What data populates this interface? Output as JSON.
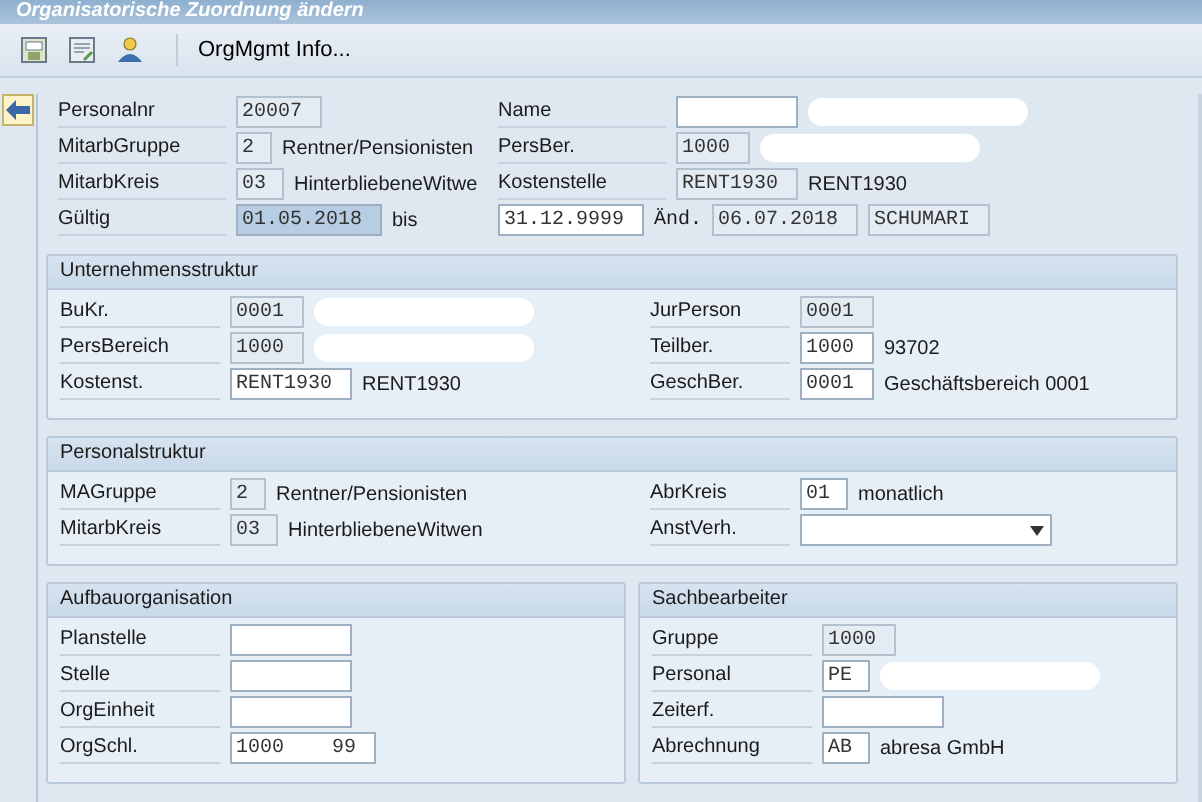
{
  "title": "Organisatorische Zuordnung ändern",
  "toolbar": {
    "info_button": "OrgMgmt Info..."
  },
  "header": {
    "rows": [
      {
        "left": [
          {
            "kind": "label",
            "text": "Personalnr"
          },
          {
            "kind": "field",
            "value": "20007",
            "editable": false
          }
        ],
        "right": [
          {
            "kind": "label",
            "text": "Name"
          },
          {
            "kind": "field",
            "editable": true
          },
          {
            "kind": "redacted"
          }
        ]
      },
      {
        "left": [
          {
            "kind": "label",
            "text": "MitarbGruppe"
          },
          {
            "kind": "field",
            "value": "2",
            "editable": false
          },
          {
            "kind": "text",
            "text": "Rentner/Pensionisten"
          }
        ],
        "right": [
          {
            "kind": "label",
            "text": "PersBer."
          },
          {
            "kind": "field",
            "value": "1000",
            "editable": false
          },
          {
            "kind": "redacted"
          }
        ]
      },
      {
        "left": [
          {
            "kind": "label",
            "text": "MitarbKreis"
          },
          {
            "kind": "field",
            "value": "03",
            "editable": false
          },
          {
            "kind": "text",
            "text": "HinterbliebeneWitwe"
          }
        ],
        "right": [
          {
            "kind": "label",
            "text": "Kostenstelle"
          },
          {
            "kind": "field",
            "value": "RENT1930",
            "editable": false
          },
          {
            "kind": "text",
            "text": "RENT1930"
          }
        ]
      },
      {
        "left": [
          {
            "kind": "label",
            "text": "Gültig"
          },
          {
            "kind": "field",
            "value": "01.05.2018",
            "editable": true,
            "highlighted": true
          },
          {
            "kind": "text",
            "text": "bis"
          }
        ],
        "right": [
          {
            "kind": "field",
            "value": "31.12.9999",
            "editable": true
          },
          {
            "kind": "mono",
            "text": "Änd."
          },
          {
            "kind": "field",
            "value": "06.07.2018",
            "editable": false
          },
          {
            "kind": "field",
            "value": "SCHUMARI",
            "editable": false
          }
        ]
      }
    ]
  },
  "sections": [
    {
      "title": "Unternehmensstruktur",
      "rows": [
        {
          "left": [
            {
              "kind": "label",
              "text": "BuKr."
            },
            {
              "kind": "field",
              "value": "0001",
              "editable": false
            },
            {
              "kind": "redacted"
            }
          ],
          "right": [
            {
              "kind": "label",
              "text": "JurPerson"
            },
            {
              "kind": "field",
              "value": "0001",
              "editable": false
            }
          ]
        },
        {
          "left": [
            {
              "kind": "label",
              "text": "PersBereich"
            },
            {
              "kind": "field",
              "value": "1000",
              "editable": false
            },
            {
              "kind": "redacted"
            }
          ],
          "right": [
            {
              "kind": "label",
              "text": "Teilber."
            },
            {
              "kind": "field",
              "value": "1000",
              "editable": true
            },
            {
              "kind": "text",
              "text": "93702"
            }
          ]
        },
        {
          "left": [
            {
              "kind": "label",
              "text": "Kostenst."
            },
            {
              "kind": "field",
              "value": "RENT1930",
              "editable": true
            },
            {
              "kind": "text",
              "text": "RENT1930"
            }
          ],
          "right": [
            {
              "kind": "label",
              "text": "GeschBer."
            },
            {
              "kind": "field",
              "value": "0001",
              "editable": true
            },
            {
              "kind": "text",
              "text": "Geschäftsbereich 0001"
            }
          ]
        }
      ]
    },
    {
      "title": "Personalstruktur",
      "rows": [
        {
          "left": [
            {
              "kind": "label",
              "text": "MAGruppe"
            },
            {
              "kind": "field",
              "value": "2",
              "editable": false
            },
            {
              "kind": "text",
              "text": "Rentner/Pensionisten"
            }
          ],
          "right": [
            {
              "kind": "label",
              "text": "AbrKreis"
            },
            {
              "kind": "field",
              "value": "01",
              "editable": true
            },
            {
              "kind": "text",
              "text": "monatlich"
            }
          ]
        },
        {
          "left": [
            {
              "kind": "label",
              "text": "MitarbKreis"
            },
            {
              "kind": "field",
              "value": "03",
              "editable": false
            },
            {
              "kind": "text",
              "text": "HinterbliebeneWitwen"
            }
          ],
          "right": [
            {
              "kind": "label",
              "text": "AnstVerh."
            },
            {
              "kind": "dropdown"
            }
          ]
        }
      ]
    }
  ],
  "bottom_sections": [
    {
      "title": "Aufbauorganisation",
      "rows": [
        {
          "left": [
            {
              "kind": "label",
              "text": "Planstelle"
            },
            {
              "kind": "field",
              "editable": true
            }
          ]
        },
        {
          "left": [
            {
              "kind": "label",
              "text": "Stelle"
            },
            {
              "kind": "field",
              "editable": true
            }
          ]
        },
        {
          "left": [
            {
              "kind": "label",
              "text": "OrgEinheit"
            },
            {
              "kind": "field",
              "editable": true
            }
          ]
        },
        {
          "left": [
            {
              "kind": "label",
              "text": "OrgSchl."
            },
            {
              "kind": "field",
              "value": "1000    99",
              "editable": true
            }
          ]
        }
      ]
    },
    {
      "title": "Sachbearbeiter",
      "rows": [
        {
          "left": [
            {
              "kind": "label",
              "text": "Gruppe"
            },
            {
              "kind": "field",
              "value": "1000",
              "editable": false
            }
          ]
        },
        {
          "left": [
            {
              "kind": "label",
              "text": "Personal"
            },
            {
              "kind": "field",
              "value": "PE",
              "editable": true
            },
            {
              "kind": "redacted"
            }
          ]
        },
        {
          "left": [
            {
              "kind": "label",
              "text": "Zeiterf."
            },
            {
              "kind": "field",
              "editable": true
            }
          ]
        },
        {
          "left": [
            {
              "kind": "label",
              "text": "Abrechnung"
            },
            {
              "kind": "field",
              "value": "AB",
              "editable": true
            },
            {
              "kind": "text",
              "text": "abresa GmbH"
            }
          ]
        }
      ]
    }
  ]
}
